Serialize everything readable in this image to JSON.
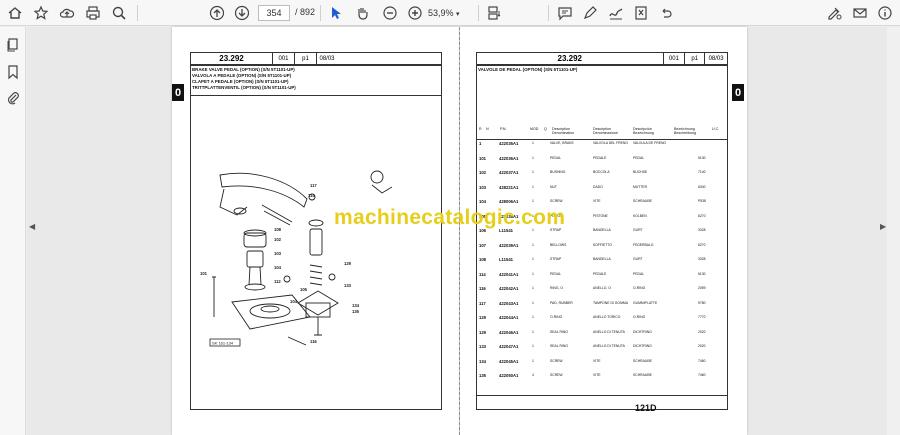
{
  "toolbar": {
    "page_current": "354",
    "page_total": "/ 892",
    "zoom": "53,9%",
    "icons": [
      "home-icon",
      "star-icon",
      "upload-icon",
      "print-icon",
      "zoom-search-icon",
      "page-up-icon",
      "page-down-icon",
      "select-cursor-icon",
      "hand-pan-icon",
      "zoom-out-icon",
      "zoom-in-icon",
      "view-mode-icon",
      "comment-icon",
      "highlight-pen-icon",
      "draw-icon",
      "delete-icon",
      "sign-icon",
      "mail-icon"
    ]
  },
  "sidebar": {
    "icons": [
      "pages-icon",
      "bookmark-icon",
      "attachment-icon"
    ]
  },
  "left_page": {
    "ref": "23.292",
    "sheet": "001",
    "part": "p1",
    "date": "08/03",
    "titles": [
      "BRAKE VALVE PEDAL (OPTION) (S/N 5T1101-UP)",
      "VALVOLA A PEDALE (OPTION) (S/N 5T1101-UP)",
      "CLAPET A PEDALE (OPTION) (S/N 5T1101-UP)",
      "TRITTPLATTENVENTIL (OPTION) (S/N 5T1101-UP)"
    ],
    "tab": "0",
    "diagram_label": "SK 161-134",
    "callouts": [
      "117",
      "114",
      "129",
      "133",
      "108",
      "102",
      "103",
      "104",
      "112",
      "104",
      "105",
      "134",
      "135",
      "116",
      "101"
    ]
  },
  "right_page": {
    "ref": "23.292",
    "sheet": "001",
    "part": "p1",
    "date": "08/03",
    "title": "VALVOLE DE PEDAL (OPTION) (S/N 5T1101-UP)",
    "tab": "0",
    "columns": [
      "R",
      "N",
      "P.N.",
      "MOD",
      "Q",
      "Description Denomination",
      "Description Denominazione",
      "Descripción Bezeichnung",
      "Bezeichnung Beschreibung",
      "U.C."
    ],
    "rows": [
      {
        "n": "1",
        "pn": "422035A1",
        "q": "1",
        "en": "VALVE, BRAKE",
        "fr": "VALVOLA DEL FRENO",
        "de": "VALVULA DE FRENO",
        "uc": ""
      },
      {
        "n": "101",
        "pn": "422036A1",
        "q": "1",
        "en": "PEDAL",
        "fr": "PEDALE",
        "de": "PEDAL",
        "uc": "6130"
      },
      {
        "n": "102",
        "pn": "422037A1",
        "q": "1",
        "en": "BUSHING",
        "fr": "BOCCOLA",
        "de": "BUCHSE",
        "uc": "7140"
      },
      {
        "n": "103",
        "pn": "428221A1",
        "q": "1",
        "en": "NUT",
        "fr": "DADO",
        "de": "MUTTER",
        "uc": "6340"
      },
      {
        "n": "104",
        "pn": "428006A1",
        "q": "1",
        "en": "SCREW",
        "fr": "VITE",
        "de": "SCHRAUBE",
        "uc": "P538"
      },
      {
        "n": "105",
        "pn": "422038A1",
        "q": "1",
        "en": "PISTON",
        "fr": "PISTONE",
        "de": "KOLBEN",
        "uc": "6270"
      },
      {
        "n": "106",
        "pn": "L11541",
        "q": "1",
        "en": "STRAP",
        "fr": "BANDELLA",
        "de": "GURT",
        "uc": "3328"
      },
      {
        "n": "107",
        "pn": "422039A1",
        "q": "1",
        "en": "BELLOWS",
        "fr": "SOFFIETTO",
        "de": "FEDERBALG",
        "uc": "6270"
      },
      {
        "n": "108",
        "pn": "L11541",
        "q": "1",
        "en": "STRAP",
        "fr": "BANDELLA",
        "de": "GURT",
        "uc": "3328"
      },
      {
        "n": "114",
        "pn": "422041A1",
        "q": "1",
        "en": "PEDAL",
        "fr": "PEDALE",
        "de": "PEDAL",
        "uc": "6130"
      },
      {
        "n": "116",
        "pn": "422042A1",
        "q": "1",
        "en": "RING, O",
        "fr": "ANELLO, O",
        "de": "O-RING",
        "uc": "2059"
      },
      {
        "n": "117",
        "pn": "422043A1",
        "q": "1",
        "en": "PAD, RUBBER",
        "fr": "TAMPONE DI GOMMA",
        "de": "GUMMIPLATTE",
        "uc": "9780"
      },
      {
        "n": "129",
        "pn": "422044A1",
        "q": "1",
        "en": "O-RING",
        "fr": "ANELLO TORICO",
        "de": "O-RING",
        "uc": "7770"
      },
      {
        "n": "129",
        "pn": "422046A1",
        "q": "1",
        "en": "SEAL RING",
        "fr": "ANELLO DI TENUTA",
        "de": "DICHTRING",
        "uc": "2020"
      },
      {
        "n": "133",
        "pn": "422047A1",
        "q": "1",
        "en": "SEAL RING",
        "fr": "ANELLO DI TENUTA",
        "de": "DICHTRING",
        "uc": "2020"
      },
      {
        "n": "134",
        "pn": "422045A1",
        "q": "1",
        "en": "SCREW",
        "fr": "VITE",
        "de": "SCHRAUBE",
        "uc": "7460"
      },
      {
        "n": "135",
        "pn": "422050A1",
        "q": "4",
        "en": "SCREW",
        "fr": "VITE",
        "de": "SCHRAUBE",
        "uc": "7460"
      }
    ],
    "model": "121D"
  },
  "watermark": "machinecatalogic.com"
}
